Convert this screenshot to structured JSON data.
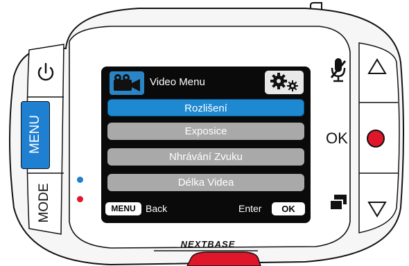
{
  "device": {
    "brand": "NEXTBASE",
    "buttons": {
      "power_icon": "power-icon",
      "menu_label": "MENU",
      "mode_label": "MODE",
      "mic_icon": "microphone-muted-icon",
      "up_icon": "triangle-up-icon",
      "ok_label": "OK",
      "record_icon": "record-dot-icon",
      "protect_icon": "protect-file-icon",
      "down_icon": "triangle-down-icon"
    },
    "leds": [
      {
        "name": "blue-led",
        "color": "#1f7fd0"
      },
      {
        "name": "red-led",
        "color": "#e0162b"
      }
    ],
    "colors": {
      "menu_button": "#1f7fd0",
      "record": "#e0162b",
      "body": "#f5f5f5"
    }
  },
  "screen": {
    "header": {
      "icon": "video-camera-icon",
      "title": "Video Menu",
      "settings_icon": "gears-icon"
    },
    "menu_items": [
      {
        "label": "Rozlišení",
        "selected": true
      },
      {
        "label": "Exposice",
        "selected": false
      },
      {
        "label": "Nhrávání Zvuku",
        "selected": false
      },
      {
        "label": "Délka Videa",
        "selected": false
      }
    ],
    "footer": {
      "menu_key": "MENU",
      "back_label": "Back",
      "enter_label": "Enter",
      "ok_key": "OK"
    },
    "colors": {
      "selected": "#1e88d0",
      "unselected": "#a9a9a9"
    }
  }
}
